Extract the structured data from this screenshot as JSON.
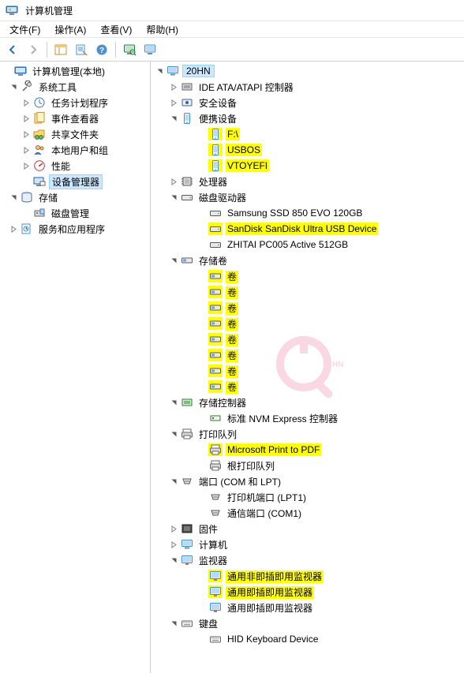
{
  "window": {
    "title": "计算机管理"
  },
  "menu": {
    "file": "文件(F)",
    "action": "操作(A)",
    "view": "查看(V)",
    "help": "帮助(H)"
  },
  "left_tree": {
    "root": "计算机管理(本地)",
    "system_tools": "系统工具",
    "task_scheduler": "任务计划程序",
    "event_viewer": "事件查看器",
    "shared_folders": "共享文件夹",
    "local_users": "本地用户和组",
    "performance": "性能",
    "device_manager": "设备管理器",
    "storage": "存储",
    "disk_mgmt": "磁盘管理",
    "services_apps": "服务和应用程序"
  },
  "right_tree": {
    "root": "20HN",
    "ide": "IDE ATA/ATAPI 控制器",
    "security": "安全设备",
    "portable": "便携设备",
    "portable_items": [
      "F:\\",
      "USBOS",
      "VTOYEFI"
    ],
    "processors": "处理器",
    "disk_drives": "磁盘驱动器",
    "disk_items": [
      "Samsung SSD 850 EVO 120GB",
      "SanDisk SanDisk Ultra USB Device",
      "ZHITAI PC005 Active 512GB"
    ],
    "volumes": "存储卷",
    "volume_label": "卷",
    "storage_ctrl": "存储控制器",
    "nvme": "标准 NVM Express 控制器",
    "print_queues": "打印队列",
    "print_items": [
      "Microsoft Print to PDF",
      "根打印队列"
    ],
    "ports": "端口 (COM 和 LPT)",
    "port_items": [
      "打印机端口 (LPT1)",
      "通信端口 (COM1)"
    ],
    "firmware": "固件",
    "computer": "计算机",
    "monitors": "监视器",
    "monitor_items": [
      "通用非即插即用监视器",
      "通用即插即用监视器",
      "通用即插即用监视器"
    ],
    "keyboards": "键盘",
    "keyboard_items": [
      "HID Keyboard Device"
    ]
  }
}
